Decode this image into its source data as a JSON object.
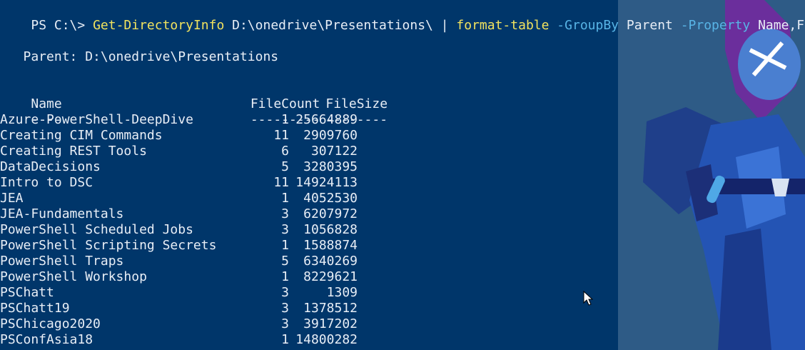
{
  "terminal": {
    "prompt": "PS C:\\> ",
    "command": {
      "cmdlet": "Get-DirectoryInfo",
      "path": " D:\\onedrive\\Presentations\\ ",
      "pipe": "|",
      "format": " format-table",
      "groupby_param": " -GroupBy",
      "groupby_value": " Parent",
      "property_param": " -Property",
      "property_value": " Name,File*"
    },
    "group_label": "   Parent: D:\\onedrive\\Presentations",
    "table": {
      "headers": [
        "Name",
        "FileCount",
        "FileSize"
      ],
      "separators": [
        "----",
        "---------",
        "--------"
      ],
      "rows": [
        {
          "name": "Azure-PowerShell-DeepDive",
          "count": "1",
          "size": "25664889"
        },
        {
          "name": "Creating CIM Commands",
          "count": "11",
          "size": "2909760"
        },
        {
          "name": "Creating REST Tools",
          "count": "6",
          "size": "307122"
        },
        {
          "name": "DataDecisions",
          "count": "5",
          "size": "3280395"
        },
        {
          "name": "Intro to DSC",
          "count": "11",
          "size": "14924113"
        },
        {
          "name": "JEA",
          "count": "1",
          "size": "4052530"
        },
        {
          "name": "JEA-Fundamentals",
          "count": "3",
          "size": "6207972"
        },
        {
          "name": "PowerShell Scheduled Jobs",
          "count": "3",
          "size": "1056828"
        },
        {
          "name": "PowerShell Scripting Secrets",
          "count": "1",
          "size": "1588874"
        },
        {
          "name": "PowerShell Traps",
          "count": "5",
          "size": "6340269"
        },
        {
          "name": "PowerShell Workshop",
          "count": "1",
          "size": "8229621"
        },
        {
          "name": "PSChatt",
          "count": "3",
          "size": "1309"
        },
        {
          "name": "PSChatt19",
          "count": "3",
          "size": "1378512"
        },
        {
          "name": "PSChicago2020",
          "count": "3",
          "size": "3917202"
        },
        {
          "name": "PSConfAsia18",
          "count": "1",
          "size": "14800282"
        }
      ]
    },
    "colors": {
      "background": "#00366a",
      "cmdlet": "#f2e35e",
      "parameter": "#58b4e6",
      "text": "#e8eef6"
    }
  }
}
